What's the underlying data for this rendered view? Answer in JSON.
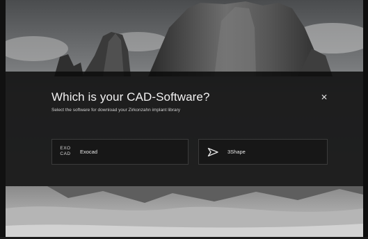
{
  "modal": {
    "title": "Which is your CAD-Software?",
    "subtitle": "Select the software for download your Zirkonzahn implant library",
    "close_icon": "close-icon",
    "options": [
      {
        "logo_line1": "EXO",
        "logo_line2": "CAD",
        "label": "Exocad",
        "icon": "exocad-logo-icon"
      },
      {
        "label": "3Shape",
        "icon": "3shape-logo-icon"
      }
    ]
  },
  "colors": {
    "overlay": "#0c0c0c",
    "text": "#f2f2f2",
    "border": "#3b3b3b"
  }
}
